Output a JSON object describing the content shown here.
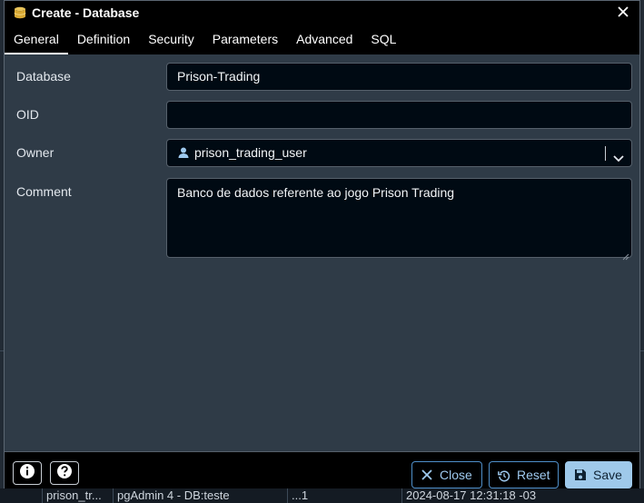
{
  "dialog": {
    "title": "Create - Database",
    "tabs": [
      "General",
      "Definition",
      "Security",
      "Parameters",
      "Advanced",
      "SQL"
    ],
    "active_tab": "General"
  },
  "form": {
    "database_label": "Database",
    "database_value": "Prison-Trading",
    "oid_label": "OID",
    "oid_value": "",
    "owner_label": "Owner",
    "owner_value": "prison_trading_user",
    "comment_label": "Comment",
    "comment_value": "Banco de dados referente ao jogo Prison Trading"
  },
  "footer": {
    "info_icon": "info-icon",
    "help_icon": "help-icon",
    "close_label": "Close",
    "reset_label": "Reset",
    "save_label": "Save"
  },
  "background_row": {
    "cells": [
      "prison_tr...",
      "pgAdmin 4 - DB:teste",
      "...1",
      "2024-08-17 12:31:18 -03"
    ]
  },
  "colors": {
    "titlebar": "#000000",
    "dialog_bg": "#2f3b47",
    "field_bg": "#000a13",
    "accent": "#9fc9ea",
    "button_border": "#4f8fc9"
  }
}
